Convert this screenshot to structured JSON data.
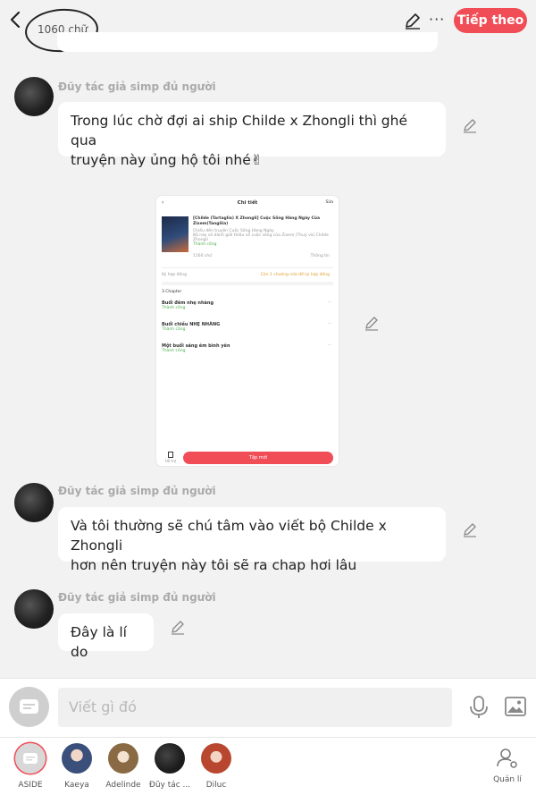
{
  "topbar": {
    "word_count": "1060 chữ",
    "next_label": "Tiếp theo",
    "more": "···"
  },
  "messages": [
    {
      "author": "Đũy tác giả simp đủ người",
      "text_lines": [
        "Trong lúc chờ đợi ai ship Childe x Zhongli thì ghé qua",
        "truyện này ủng hộ tôi nhé✌"
      ]
    },
    {
      "author": "Đũy tác giả simp đủ người",
      "text_lines": [
        "Và tôi thường sẽ chú tâm vào viết bộ Childe x Zhongli",
        "hơn nên truyện này tôi sẽ ra chap hơi lâu"
      ]
    },
    {
      "author": "Đũy tác giả simp đủ người",
      "text_lines": [
        "Đây là lí do"
      ]
    }
  ],
  "screenshot": {
    "title": "Chi tiết",
    "edit": "Sửa",
    "book_title": "[Childe (Tartaglia) X Zhongli] Cuộc Sống Hàng Ngày Của Zixem(Tangilia)",
    "book_meta": "Chiếu đến truyện Cuộc Sống Hàng Ngày",
    "book_desc": "Bộ này sẽ dành giới thiệu về cuộc sống của Zixem (Thuỳ và) Childe Zhongli",
    "status": "Thành công",
    "stats": "1160 chữ",
    "share": "Thông tin",
    "contract": "Ký hợp đồng",
    "contract_note": "Còn 1 chương nữa để ký hợp đồng",
    "chapters_count": "3 Chapter",
    "chapters": [
      {
        "title": "Buổi đêm nhẹ nhàng",
        "status": "Thành công"
      },
      {
        "title": "Buổi chiều NHẸ NHÀNG",
        "status": "Thành công"
      },
      {
        "title": "Một buổi sáng êm bình yên",
        "status": "Thành công"
      }
    ],
    "sidebar_label": "Hỗ trợ",
    "new_chapter": "Tập mới"
  },
  "composer": {
    "placeholder": "Viết gì đó"
  },
  "characters": [
    {
      "name": "ASIDE",
      "color": "#d8d8d8"
    },
    {
      "name": "Kaeya",
      "color": "#3a4f7a"
    },
    {
      "name": "Adelinde",
      "color": "#8a6a45"
    },
    {
      "name": "Đũy tác ...",
      "color": "#1c1c1c"
    },
    {
      "name": "Diluc",
      "color": "#b9472f"
    }
  ],
  "manage_label": "Quản lí",
  "colors": {
    "accent": "#f04d57",
    "background": "#f2f2f2",
    "bubble": "#ffffff",
    "author": "#aaaaaa"
  }
}
